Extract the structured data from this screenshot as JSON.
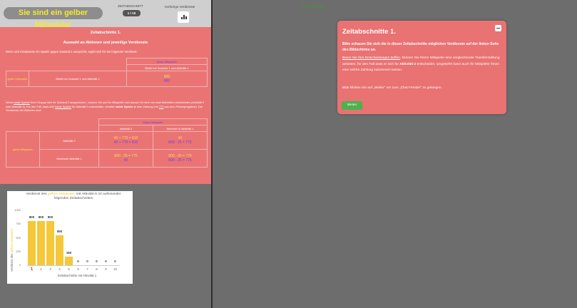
{
  "header": {
    "player_badge": "Sie sind ein gelber Mitspieler",
    "period_label": "ZEITABSCHNITT",
    "period_value": "1 / 10",
    "previous_label": "Vorherige Verdienste"
  },
  "panel": {
    "title": "Zeitabschnitte 1.",
    "subtitle": "Auswahl an Aktionen und jeweilige Verdienste",
    "intro": "Wenn sich mindestens ein Spieler gegen Zustand 2 ausspricht, ergibt sich für Sie folgender Verdienst:",
    "table1": {
      "header": "blaue Mitspieler",
      "subheader": "Bleibt bei Zustand 1 und Aktivität 1",
      "row_label": "gelbe Mitspieler",
      "row_action": "Bleibt bei Zustand 1 und Aktivität 1",
      "value_top": "800",
      "value_bottom": "800"
    },
    "paragraph_pre": "Wenn ",
    "paragraph_u1": "beide Spieler",
    "paragraph_mid": " Ihrer Gruppe sich für Zustand 2 aussprechen, müssen Sie und Ihr Mitspieler sich danach für eine von zwei Aktivitäten entscheiden (Aktivität 2 oder Aktivität 3). Für den Fall, dass sich ",
    "paragraph_u2": "beide Spieler",
    "paragraph_mid2": " für Aktivität 2 entscheiden, erhalten ",
    "paragraph_bold": "beide Spieler",
    "paragraph_mid3": " je eine Zahlung von ",
    "paragraph_u3": "770",
    "paragraph_end": " aus dem Förderprogramm. Die Verdienste der Aktionen sind:",
    "table2": {
      "header": "blaue Mitspieler",
      "col1": "Aktivität 2",
      "col2": "Wechsel in Aktivität 1",
      "row_label": "gelbe Mitspieler",
      "row1": "Aktivität 2",
      "row2": "Wechseln Aktivität 1",
      "c11_top": "40 + 770 = 810",
      "c11_bottom": "40 + 770 = 810",
      "c12_top": "40",
      "c12_bottom": "800 - 25 = 775",
      "c21_top": "800 - 25 = 775",
      "c21_bottom": "40",
      "c22_top": "800 - 25 = 775",
      "c22_bottom": "800 - 25 = 775"
    }
  },
  "chart_data": {
    "type": "bar",
    "title_pre": "Verdienst des ",
    "title_highlight": "gelben Mitspielers",
    "title_post": " mit Aktivität in 10 aufeinander folgenden Zeitabschnitten",
    "ylabel_pre": "Verdienst des ",
    "ylabel_highlight": "gelben Mitspielers",
    "xlabel": "Zeitabschnitte mit Aktivität 1",
    "categories": [
      "1",
      "2",
      "3",
      "4",
      "5",
      "6",
      "7",
      "8",
      "9",
      "10"
    ],
    "values": [
      800,
      800,
      800,
      550,
      160,
      0,
      0,
      0,
      0,
      0
    ],
    "ylim": [
      0,
      1000
    ],
    "yticks": [
      "0",
      "250",
      "500",
      "750",
      "1000"
    ],
    "highlight_category": "1",
    "color": "#f5c83a"
  },
  "status": {
    "connection": "Connected"
  },
  "modal": {
    "title": "Zeitabschnitte 1.",
    "bold_text": "Bitte schauen Sie sich die in dieser Zeitabschnitte möglichen Verdienste auf der linken Seite des Bildschirms an.",
    "p_underline": "Bevor Sie Ihre Entscheidungen treffen",
    "p_text": ", können Sie Ihrem Mitspieler eine vergleichende Transferzahlung anbieten, für den Fall dass er sich für ",
    "p_bold": "Aktivität 2",
    "p_text2": " entscheidet, umgekehrt kann auch Ihr Mitspieler Ihnen eine solche Zahlung zukommen lassen.",
    "instruction": "Bitte klicken Sie auf „Weiter\" um zum „Chat Fenster\" zu gelangen.",
    "button": "Weiter"
  },
  "colors": {
    "panel": "#ea7474",
    "yellow": "#f3e34a",
    "purple": "#6a3cf5",
    "green_button": "#4fb04f"
  }
}
